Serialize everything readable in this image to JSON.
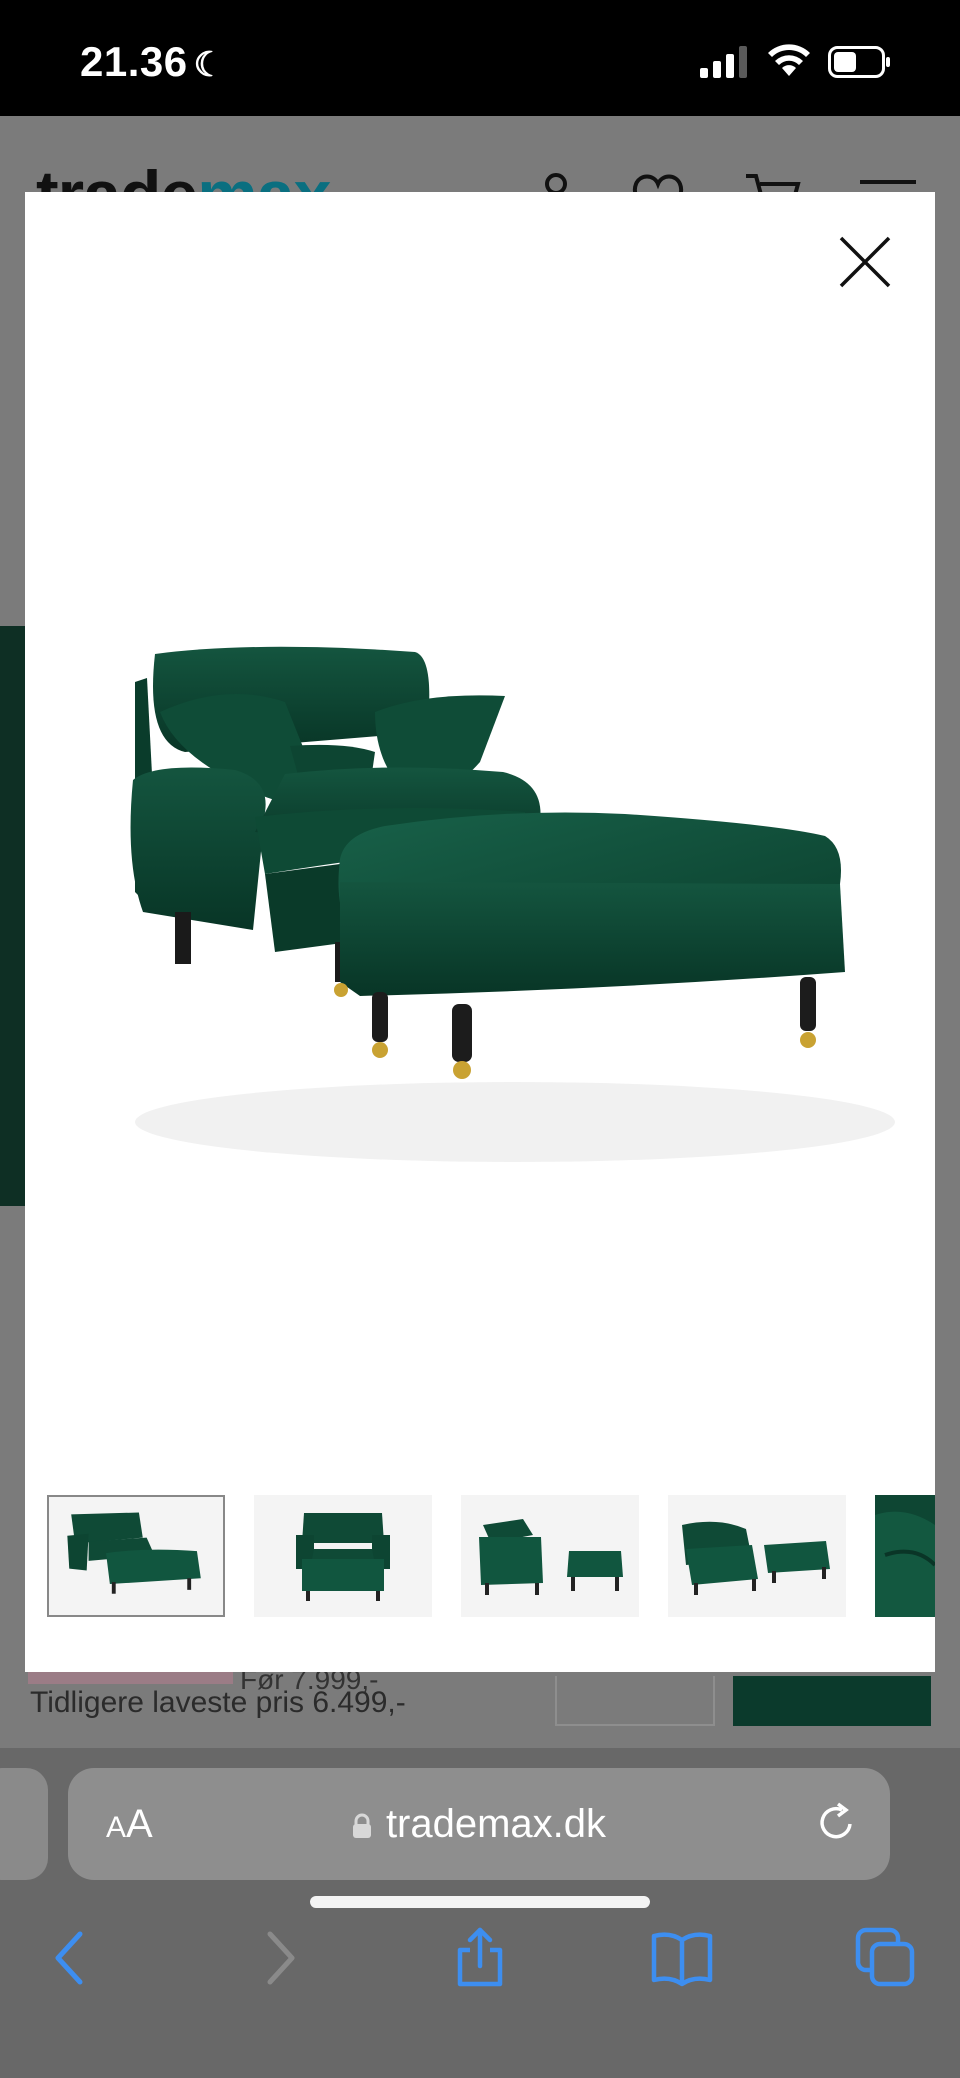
{
  "status_bar": {
    "time": "21.36",
    "moon_icon": "crescent-moon-icon",
    "icons": [
      "cellular-signal-icon",
      "wifi-icon",
      "battery-icon"
    ]
  },
  "background_page": {
    "logo_part1": "trade",
    "logo_part2": "max",
    "header_icons": [
      "user-icon",
      "heart-icon",
      "cart-icon",
      "menu-icon"
    ],
    "strike_price": "Før 7.999,-",
    "previous_lowest_price": "Tidligere laveste pris 6.499,-"
  },
  "modal": {
    "close_icon": "close-x-icon",
    "main_image_alt": "Green velvet armchair with footstool",
    "thumbnails": [
      {
        "alt": "Armchair with footstool angled view",
        "selected": true
      },
      {
        "alt": "Armchair with footstool front view",
        "selected": false
      },
      {
        "alt": "Armchair and footstool side view",
        "selected": false
      },
      {
        "alt": "Armchair and footstool rear view",
        "selected": false
      },
      {
        "alt": "Close-up fabric detail",
        "selected": false
      }
    ]
  },
  "safari": {
    "text_size_label_small": "A",
    "text_size_label_large": "A",
    "domain": "trademax.dk",
    "lock_icon": "lock-icon",
    "reload_icon": "reload-icon",
    "nav_icons": [
      "back-icon",
      "forward-icon",
      "share-icon",
      "bookmarks-icon",
      "tabs-icon"
    ]
  },
  "colors": {
    "velvet_green": "#0d4a36",
    "brand_teal": "#0a6f80",
    "safari_blue": "#3d8ef0"
  }
}
